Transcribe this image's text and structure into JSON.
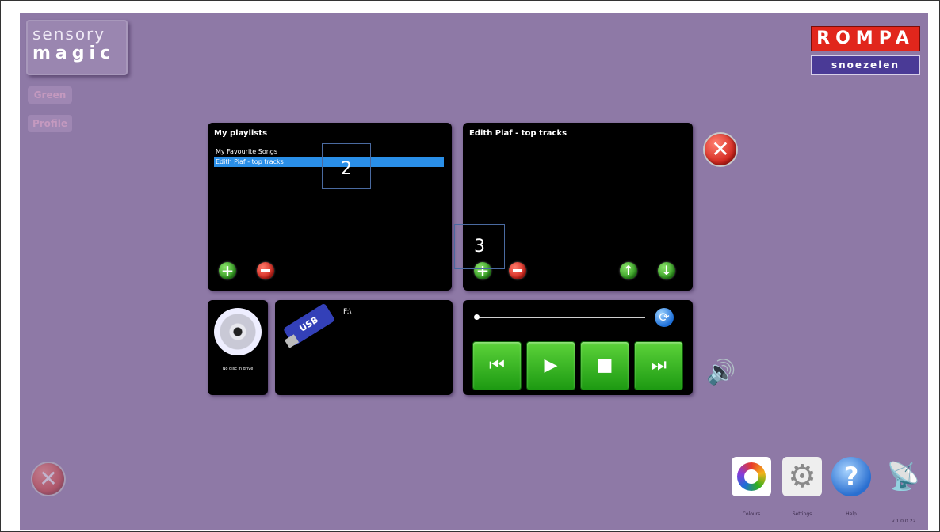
{
  "logo": {
    "line1": "sensory",
    "line2": "magic"
  },
  "side": {
    "btn1": "Green",
    "btn2": "Profile"
  },
  "brand": {
    "top": "ROMPA",
    "bottom": "snoezelen"
  },
  "playlists": {
    "title": "My playlists",
    "items": [
      "My Favourite Songs",
      "Edith Piaf - top tracks"
    ],
    "selected_index": 1
  },
  "tracks": {
    "title": "Edith Piaf - top tracks"
  },
  "annotations": {
    "a2": "2",
    "a3": "3"
  },
  "cd": {
    "label": "No disc in drive"
  },
  "usb": {
    "label": "USB",
    "drive": "F:\\"
  },
  "player": {
    "progress": 0.0
  },
  "tools": {
    "colour": "Colours",
    "settings": "Settings",
    "help": "Help"
  },
  "version": "v 1.0.0.22",
  "colors": {
    "background": "#8e79a6",
    "accent": "#2a8fe8",
    "player_green": "#2fb01e"
  }
}
